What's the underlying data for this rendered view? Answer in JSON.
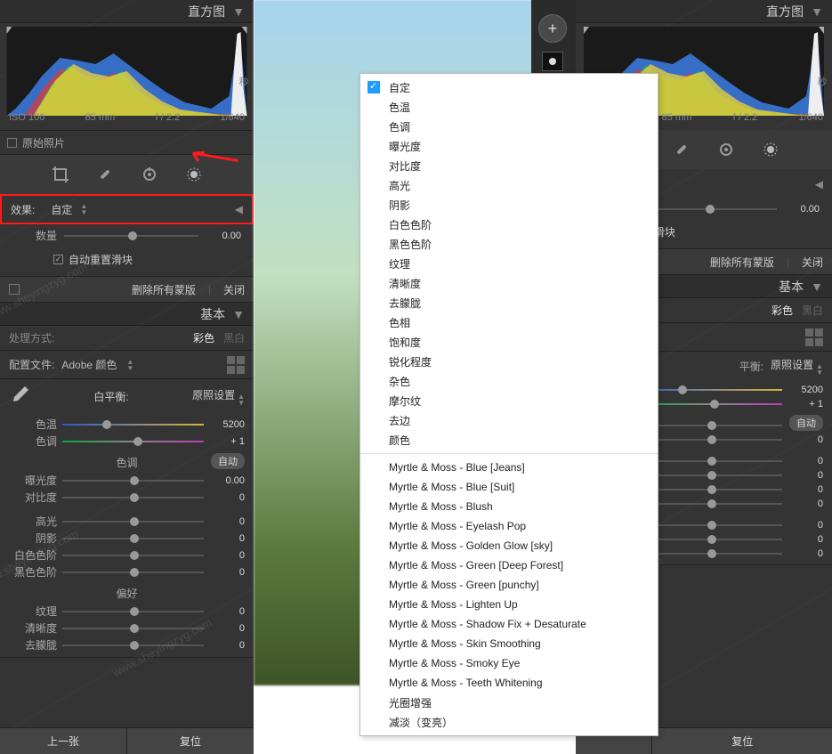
{
  "histogram": {
    "header": "直方图",
    "iso": "ISO 100",
    "focal": "85 mm",
    "aperture": "f / 2.2",
    "shutter": "1/640",
    "sec_suffix": "秒"
  },
  "original_photo": "原始照片",
  "effect": {
    "label": "效果:",
    "selected": "自定",
    "amount_label": "数量",
    "amount_value": "0.00",
    "auto_reset": "自动重置滑块"
  },
  "maskbar": {
    "delete_all": "删除所有蒙版",
    "close": "关闭"
  },
  "basic": {
    "header": "基本",
    "treat_label": "处理方式:",
    "treat_color": "彩色",
    "treat_bw": "黑白",
    "profile_label": "配置文件:",
    "profile_value": "Adobe 颜色",
    "wb_label": "白平衡:",
    "wb_preset": "原照设置",
    "temp_label": "色温",
    "temp_value": "5200",
    "tint_label": "色调",
    "tint_value": "+ 1",
    "tone_header": "色调",
    "auto": "自动",
    "sliders": [
      {
        "label": "曝光度",
        "value": "0.00"
      },
      {
        "label": "对比度",
        "value": "0"
      },
      {
        "label": "高光",
        "value": "0"
      },
      {
        "label": "阴影",
        "value": "0"
      },
      {
        "label": "白色色阶",
        "value": "0"
      },
      {
        "label": "黑色色阶",
        "value": "0"
      }
    ],
    "presence_header": "偏好",
    "presence": [
      {
        "label": "纹理",
        "value": "0"
      },
      {
        "label": "清晰度",
        "value": "0"
      },
      {
        "label": "去朦胧",
        "value": "0"
      }
    ],
    "prev": "上一张",
    "reset": "复位"
  },
  "menu": {
    "builtins": [
      "自定",
      "色温",
      "色调",
      "曝光度",
      "对比度",
      "高光",
      "阴影",
      "白色色阶",
      "黑色色阶",
      "纹理",
      "清晰度",
      "去朦胧",
      "色相",
      "饱和度",
      "锐化程度",
      "杂色",
      "摩尔纹",
      "去边",
      "颜色"
    ],
    "presets": [
      "Myrtle & Moss - Blue [Jeans]",
      "Myrtle & Moss - Blue [Suit]",
      "Myrtle & Moss - Blush",
      "Myrtle & Moss - Eyelash Pop",
      "Myrtle & Moss - Golden Glow [sky]",
      "Myrtle & Moss - Green [Deep Forest]",
      "Myrtle & Moss - Green [punchy]",
      "Myrtle & Moss - Lighten Up",
      "Myrtle & Moss - Shadow Fix + Desaturate",
      "Myrtle & Moss - Skin Smoothing",
      "Myrtle & Moss - Smoky Eye",
      "Myrtle & Moss - Teeth Whitening",
      "光圈增强",
      "减淡（变亮）"
    ]
  },
  "watermark": "www.sheyingzyg.com"
}
